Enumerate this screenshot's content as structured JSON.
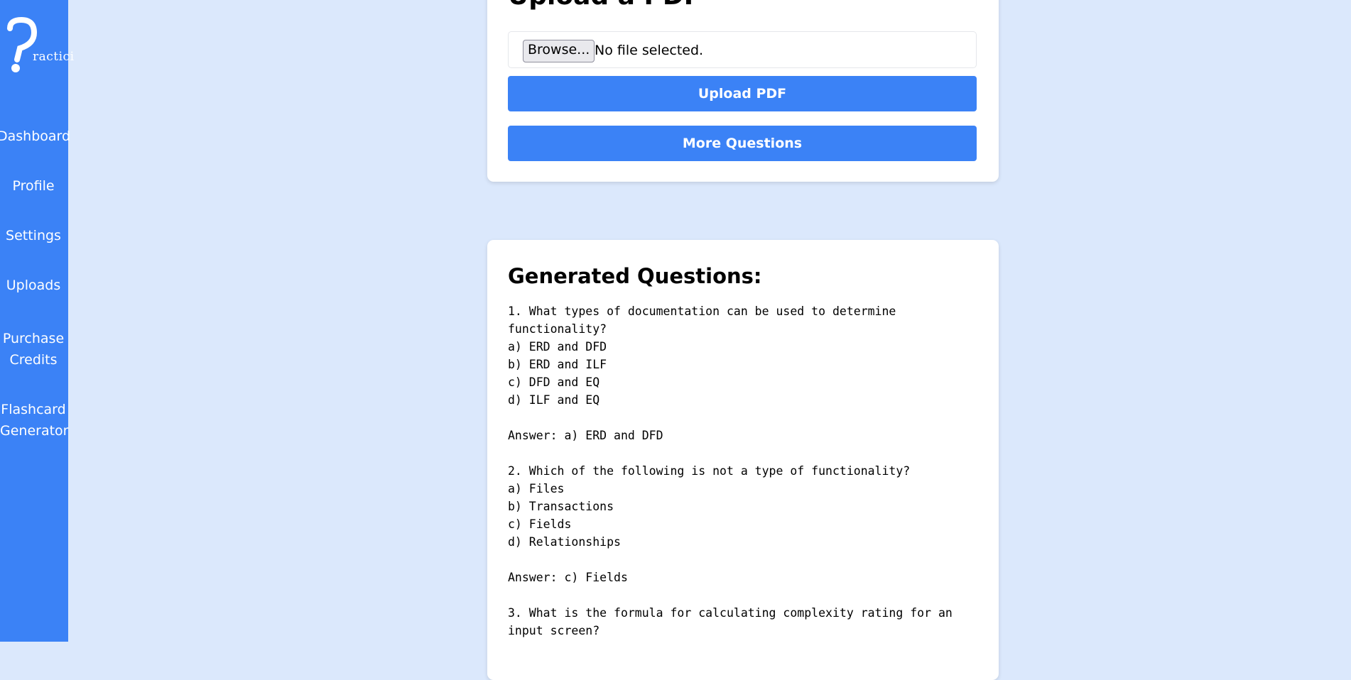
{
  "sidebar": {
    "logo_text": "ractici",
    "items": [
      {
        "label": "Dashboard"
      },
      {
        "label": "Profile"
      },
      {
        "label": "Settings"
      },
      {
        "label": "Uploads"
      },
      {
        "label": "Purchase\nCredits"
      },
      {
        "label": "Flashcard\nGenerator"
      }
    ]
  },
  "upload": {
    "title": "Upload a PDF",
    "browse_label": "Browse...",
    "file_status": "No file selected.",
    "upload_button": "Upload PDF",
    "more_button": "More Questions"
  },
  "questions": {
    "title": "Generated Questions:",
    "text": "1. What types of documentation can be used to determine functionality?\na) ERD and DFD\nb) ERD and ILF\nc) DFD and EQ\nd) ILF and EQ\n\nAnswer: a) ERD and DFD\n\n2. Which of the following is not a type of functionality?\na) Files\nb) Transactions\nc) Fields\nd) Relationships\n\nAnswer: c) Fields\n\n3. What is the formula for calculating complexity rating for an input screen?"
  },
  "colors": {
    "sidebar": "#3b82f6",
    "background": "#dbe8fc",
    "button": "#3b82f6"
  }
}
